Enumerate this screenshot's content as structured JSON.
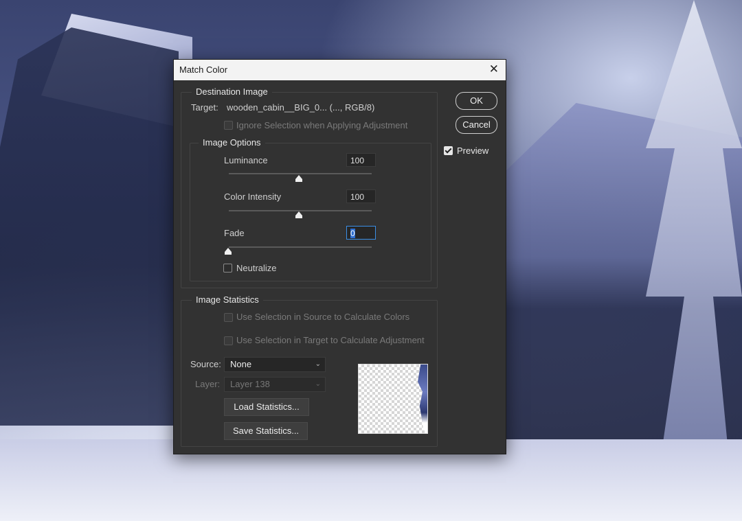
{
  "dialog": {
    "title": "Match Color",
    "close_glyph": "✕",
    "destination": {
      "group_label": "Destination Image",
      "target_label": "Target:",
      "target_value": "wooden_cabin__BIG_0... (..., RGB/8)",
      "ignore_selection_label": "Ignore Selection when Applying Adjustment"
    },
    "image_options": {
      "group_label": "Image Options",
      "luminance_label": "Luminance",
      "luminance_value": "100",
      "luminance_level": 1.0,
      "color_intensity_label": "Color Intensity",
      "color_intensity_value": "100",
      "color_intensity_level": 1.0,
      "fade_label": "Fade",
      "fade_value": "0",
      "fade_level": 0.0,
      "neutralize_label": "Neutralize"
    },
    "image_statistics": {
      "group_label": "Image Statistics",
      "use_selection_source_label": "Use Selection in Source to Calculate Colors",
      "use_selection_target_label": "Use Selection in Target to Calculate Adjustment",
      "source_label": "Source:",
      "source_value": "None",
      "layer_label": "Layer:",
      "layer_value": "Layer 138",
      "load_stats_label": "Load Statistics...",
      "save_stats_label": "Save Statistics..."
    },
    "buttons": {
      "ok_label": "OK",
      "cancel_label": "Cancel",
      "preview_label": "Preview",
      "preview_checked": true
    }
  }
}
